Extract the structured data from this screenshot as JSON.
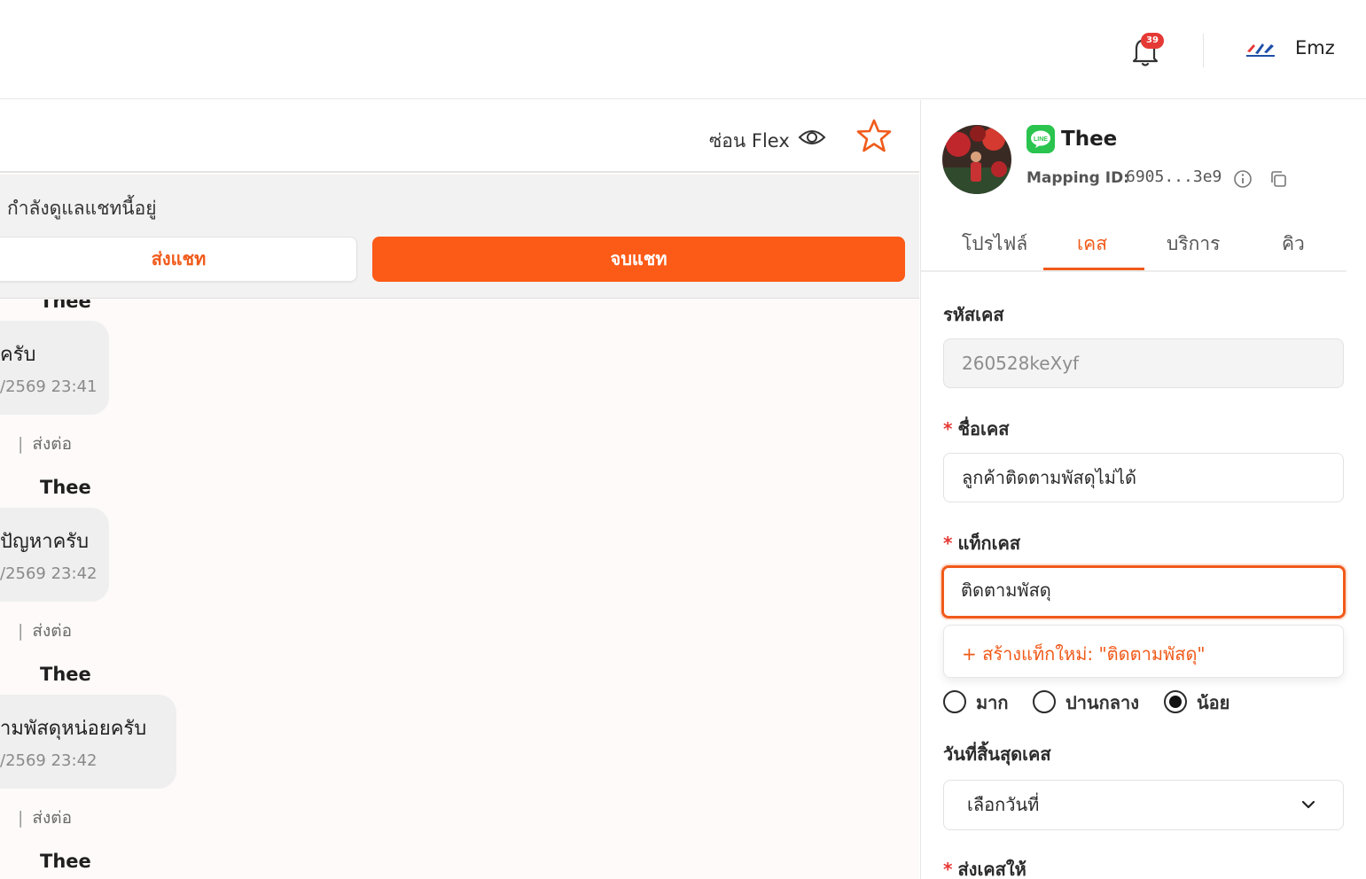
{
  "header": {
    "notification_count": "39",
    "username": "Emz"
  },
  "chat": {
    "toolbar": {
      "hide_flex_label": "ซ่อน Flex"
    },
    "care_status": "กำลังดูแลแชทนี้อยู่",
    "send_chat_label": "ส่งแชท",
    "end_chat_label": "จบแชท",
    "messages": [
      {
        "sender": "Thee",
        "text": "ครับ",
        "time": "/2569 23:41",
        "action_forward": "ส่งต่อ"
      },
      {
        "sender": "Thee",
        "text": "ปัญหาครับ",
        "time": "/2569 23:42",
        "action_forward": "ส่งต่อ"
      },
      {
        "sender": "Thee",
        "text": "ามพัสดุหน่อยครับ",
        "time": "/2569 23:42",
        "action_forward": "ส่งต่อ"
      },
      {
        "sender": "Thee"
      }
    ]
  },
  "case_panel": {
    "contact_name": "Thee",
    "mapping_label": "Mapping ID:",
    "mapping_value": "6905...3e9",
    "tabs": [
      {
        "label": "โปรไฟล์",
        "active": false
      },
      {
        "label": "เคส",
        "active": true
      },
      {
        "label": "บริการ",
        "active": false
      },
      {
        "label": "คิว",
        "active": false
      }
    ],
    "case_id_label": "รหัสเคส",
    "case_id_value": "260528keXyf",
    "case_name_label": "ชื่อเคส",
    "case_name_value": "ลูกค้าติดตามพัสดุไม่ได้",
    "case_tag_label": "แท็กเคส",
    "case_tag_value": "ติดตามพัสดุ",
    "create_tag_option": "+ สร้างแท็กใหม่: \"ติดตามพัสดุ\"",
    "priority_options": [
      {
        "label": "มาก",
        "checked": false
      },
      {
        "label": "ปานกลาง",
        "checked": false
      },
      {
        "label": "น้อย",
        "checked": true
      }
    ],
    "due_date_label": "วันที่สิ้นสุดเคส",
    "due_date_placeholder": "เลือกวันที่",
    "assign_label": "ส่งเคสให้"
  },
  "colors": {
    "accent": "#fc5a17",
    "badge": "#e53935",
    "line_green": "#2ac44f"
  }
}
